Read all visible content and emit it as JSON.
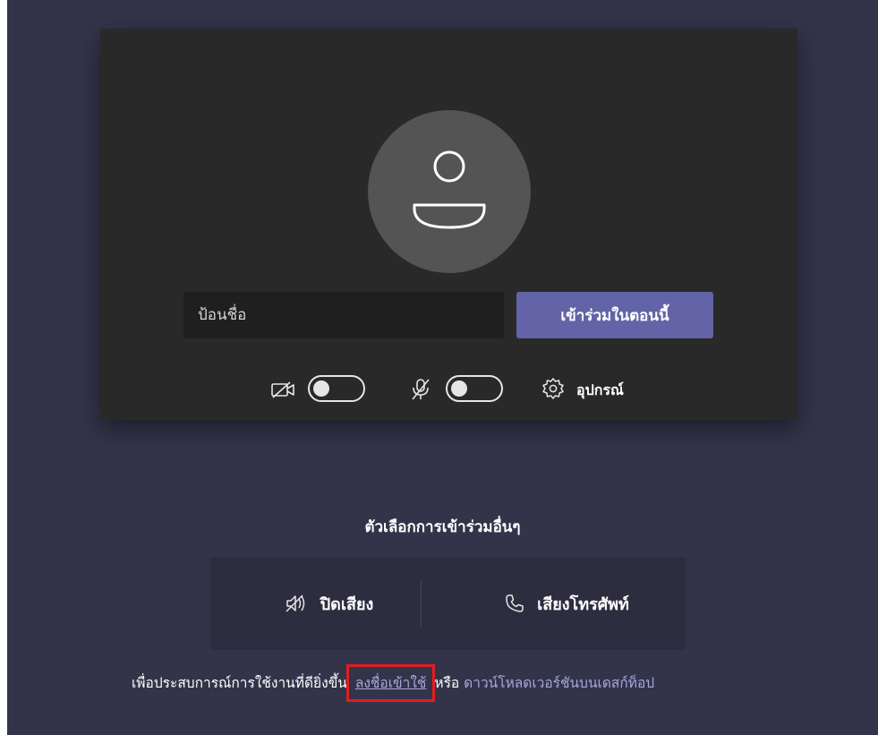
{
  "name_input": {
    "placeholder": "ป้อนชื่อ"
  },
  "join_button": {
    "label": "เข้าร่วมในตอนนี้"
  },
  "devices": {
    "label": "อุปกรณ์"
  },
  "video_toggle": {
    "state": "off",
    "icon": "video-off-icon"
  },
  "mic_toggle": {
    "state": "off",
    "icon": "mic-off-icon"
  },
  "other_options": {
    "title": "ตัวเลือกการเข้าร่วมอื่นๆ",
    "audio_off": {
      "label": "ปิดเสียง",
      "icon": "speaker-off-icon"
    },
    "phone_audio": {
      "label": "เสียงโทรศัพท์",
      "icon": "phone-icon"
    }
  },
  "footer": {
    "prefix": "เพื่อประสบการณ์การใช้งานที่ดียิ่งขึ้น",
    "signin_link": "ลงชื่อเข้าใช้",
    "middle": "หรือ",
    "download_link": "ดาวน์โหลดเวอร์ชันบนเดสก์ท็อป"
  },
  "colors": {
    "background": "#33344a",
    "panel": "#292929",
    "accent": "#6264a7",
    "link": "#a6a7dc",
    "highlight": "#e31d1d"
  }
}
